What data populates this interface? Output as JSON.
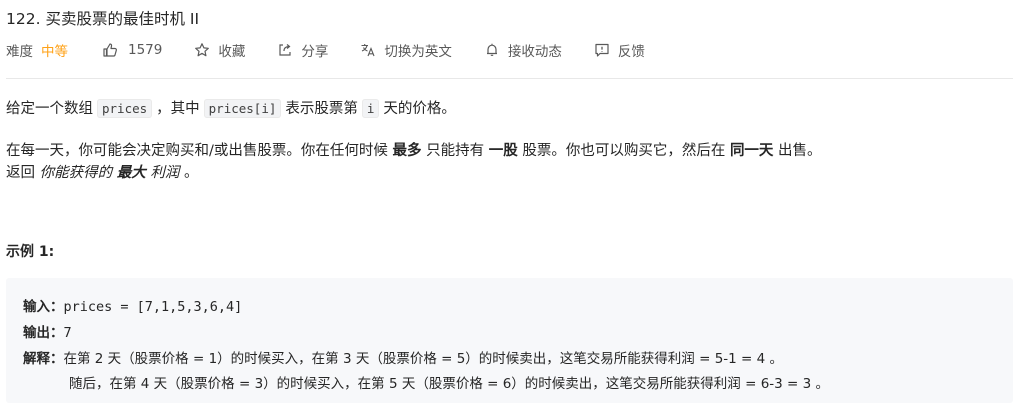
{
  "problem": {
    "title": "122. 买卖股票的最佳时机 II"
  },
  "meta": {
    "difficulty_label": "难度",
    "difficulty_value": "中等",
    "difficulty_color": "#ffa116",
    "likes": "1579",
    "favorite": "收藏",
    "share": "分享",
    "switch_lang": "切换为英文",
    "subscribe": "接收动态",
    "feedback": "反馈",
    "icons": [
      "thumbs-up-icon",
      "star-icon",
      "share-icon",
      "translate-icon",
      "bell-icon",
      "feedback-icon"
    ]
  },
  "description": {
    "p1_a": "给定一个数组",
    "p1_code1": "prices",
    "p1_b": "，其中",
    "p1_code2": "prices[i]",
    "p1_c": "表示股票第",
    "p1_code3": "i",
    "p1_d": "天的价格。",
    "p2_a": "在每一天，你可能会决定购买和/或出售股票。你在任何时候",
    "p2_b1": "最多",
    "p2_c": "只能持有",
    "p2_b2": "一股",
    "p2_d": "股票。你也可以购买它，然后在",
    "p2_b3": "同一天",
    "p2_e": "出售。",
    "p3_a": "返回",
    "p3_i1": "你能获得的",
    "p3_b": "最大",
    "p3_i2": "利润",
    "p3_c": "。"
  },
  "example1": {
    "title": "示例 1:",
    "input_label": "输入：",
    "input_value": "prices = [7,1,5,3,6,4]",
    "output_label": "输出：",
    "output_value": "7",
    "explain_label": "解释：",
    "explain_line1": "在第 2 天（股票价格 = 1）的时候买入，在第 3 天（股票价格 = 5）的时候卖出，这笔交易所能获得利润 = 5-1 = 4 。",
    "explain_line2": "随后，在第 4 天（股票价格 = 3）的时候买入，在第 5 天（股票价格 = 6）的时候卖出，这笔交易所能获得利润 = 6-3 = 3 。"
  }
}
